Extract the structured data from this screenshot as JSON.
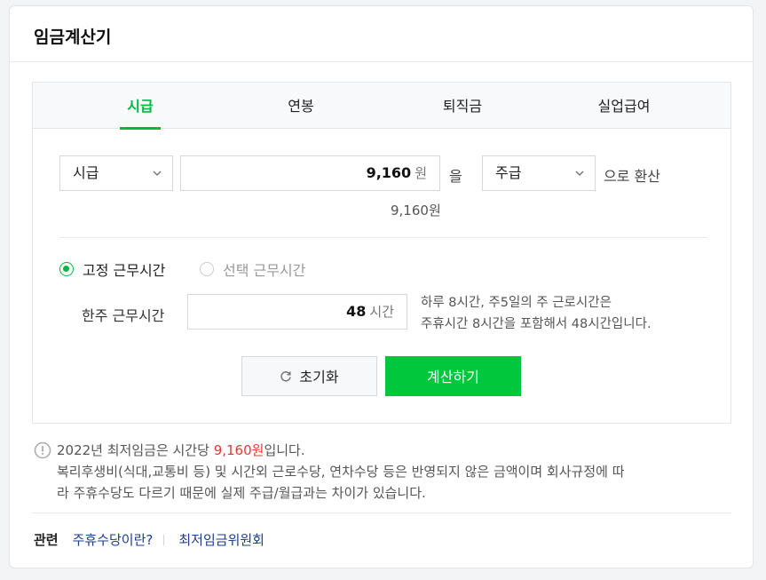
{
  "card": {
    "title": "임금계산기"
  },
  "tabs": [
    {
      "label": "시급",
      "active": true
    },
    {
      "label": "연봉",
      "active": false
    },
    {
      "label": "퇴직금",
      "active": false
    },
    {
      "label": "실업급여",
      "active": false
    }
  ],
  "converter": {
    "from_unit": "시급",
    "amount": "9,160",
    "amount_unit": "원",
    "particle": "을",
    "to_unit": "주급",
    "suffix": "으로 환산",
    "result": "9,160원"
  },
  "work_time": {
    "options": [
      {
        "label": "고정 근무시간",
        "selected": true
      },
      {
        "label": "선택 근무시간",
        "selected": false
      }
    ],
    "weekly_label": "한주 근무시간",
    "hours": "48",
    "hours_unit": "시간",
    "desc_line1": "하루 8시간, 주5일의 주 근로시간은",
    "desc_line2": "주휴시간 8시간을 포함해서 48시간입니다."
  },
  "buttons": {
    "reset": "초기화",
    "calculate": "계산하기"
  },
  "notice": {
    "line1_pre": "2022년 최저임금은 시간당 ",
    "line1_wage": "9,160원",
    "line1_post": "입니다.",
    "line2": "복리후생비(식대,교통비 등) 및 시간외 근로수당, 연차수당 등은 반영되지 않은 금액이며 회사규정에 따",
    "line3": "라 주휴수당도 다르기 때문에 실제 주급/월급과는 차이가 있습니다."
  },
  "related": {
    "label": "관련",
    "links": [
      "주휴수당이란?",
      "최저임금위원회"
    ]
  },
  "colors": {
    "accent": "#00b843",
    "button": "#00c73c",
    "highlight": "#e53935",
    "link": "#1a3d8f"
  }
}
